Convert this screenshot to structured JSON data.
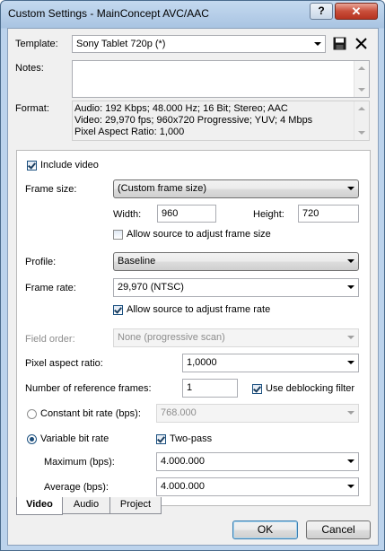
{
  "window": {
    "title": "Custom Settings - MainConcept AVC/AAC",
    "help_label": "?",
    "close_label": "✕"
  },
  "template": {
    "label": "Template:",
    "value": "Sony Tablet 720p (*)"
  },
  "notes": {
    "label": "Notes:",
    "value": ""
  },
  "format": {
    "label": "Format:",
    "lines": [
      "Audio: 192 Kbps; 48.000 Hz; 16 Bit; Stereo; AAC",
      "Video: 29,970 fps; 960x720 Progressive; YUV; 4 Mbps",
      "Pixel Aspect Ratio: 1,000"
    ]
  },
  "video": {
    "include_video": "Include video",
    "frame_size": {
      "label": "Frame size:",
      "value": "(Custom frame size)"
    },
    "width": {
      "label": "Width:",
      "value": "960"
    },
    "height": {
      "label": "Height:",
      "value": "720"
    },
    "allow_frame_size": "Allow source to adjust frame size",
    "profile": {
      "label": "Profile:",
      "value": "Baseline"
    },
    "frame_rate": {
      "label": "Frame rate:",
      "value": "29,970 (NTSC)"
    },
    "allow_frame_rate": "Allow source to adjust frame rate",
    "field_order": {
      "label": "Field order:",
      "value": "None (progressive scan)"
    },
    "pixel_aspect": {
      "label": "Pixel aspect ratio:",
      "value": "1,0000"
    },
    "ref_frames": {
      "label": "Number of reference frames:",
      "value": "1"
    },
    "deblocking": "Use deblocking filter",
    "cbr": {
      "label": "Constant bit rate (bps):",
      "value": "768.000"
    },
    "vbr": {
      "label": "Variable bit rate"
    },
    "two_pass": "Two-pass",
    "maximum": {
      "label": "Maximum (bps):",
      "value": "4.000.000"
    },
    "average": {
      "label": "Average (bps):",
      "value": "4.000.000"
    }
  },
  "tabs": [
    "Video",
    "Audio",
    "Project"
  ],
  "buttons": {
    "ok": "OK",
    "cancel": "Cancel"
  }
}
